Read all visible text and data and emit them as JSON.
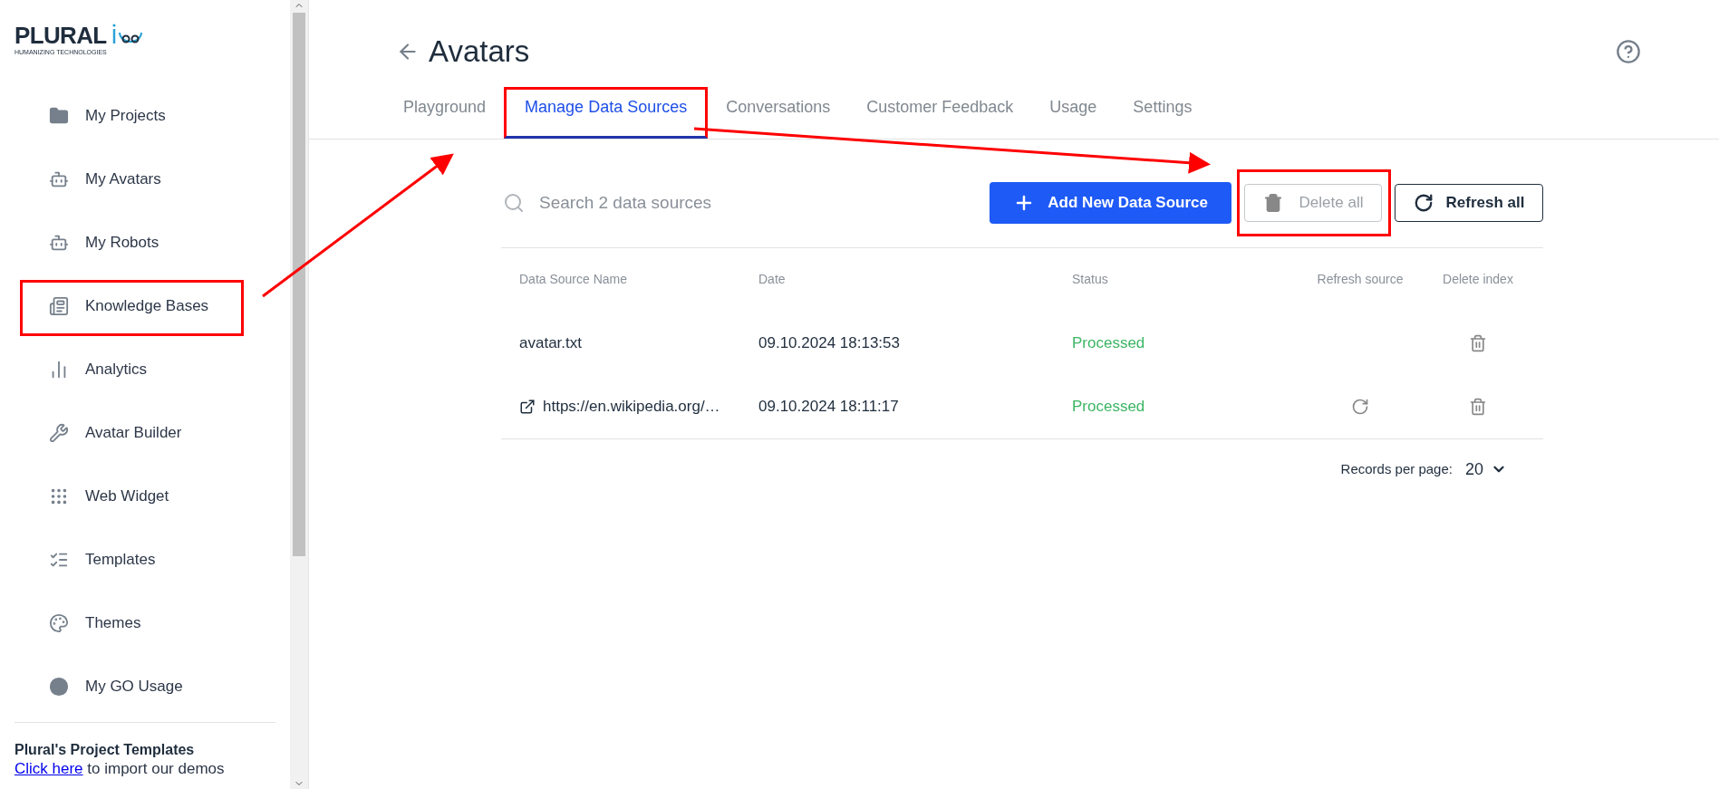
{
  "logo": {
    "name": "PLURAL",
    "tagline": "HUMANIZING TECHNOLOGIES"
  },
  "sidebar": {
    "items": [
      {
        "label": "My Projects",
        "highlighted": false
      },
      {
        "label": "My Avatars",
        "highlighted": false
      },
      {
        "label": "My Robots",
        "highlighted": false
      },
      {
        "label": "Knowledge Bases",
        "highlighted": true
      },
      {
        "label": "Analytics",
        "highlighted": false
      },
      {
        "label": "Avatar Builder",
        "highlighted": false
      },
      {
        "label": "Web Widget",
        "highlighted": false
      },
      {
        "label": "Templates",
        "highlighted": false
      },
      {
        "label": "Themes",
        "highlighted": false
      },
      {
        "label": "My GO Usage",
        "highlighted": false
      }
    ],
    "promo": {
      "title": "Plural's Project Templates",
      "link": "Click here",
      "text": " to import our demos"
    }
  },
  "header": {
    "title": "Avatars"
  },
  "tabs": [
    {
      "label": "Playground",
      "selected": false
    },
    {
      "label": "Manage Data Sources",
      "selected": true
    },
    {
      "label": "Conversations",
      "selected": false
    },
    {
      "label": "Customer Feedback",
      "selected": false
    },
    {
      "label": "Usage",
      "selected": false
    },
    {
      "label": "Settings",
      "selected": false
    }
  ],
  "search": {
    "placeholder": "Search 2 data sources"
  },
  "buttons": {
    "add": "Add New Data Source",
    "delete_all": "Delete all",
    "delete_all_disabled": true,
    "refresh_all": "Refresh all"
  },
  "table": {
    "columns": [
      "Data Source Name",
      "Date",
      "Status",
      "Refresh source",
      "Delete index"
    ],
    "rows": [
      {
        "kind": "file",
        "name": "avatar.txt",
        "date": "09.10.2024 18:13:53",
        "status": "Processed"
      },
      {
        "kind": "link",
        "name": "https://en.wikipedia.org/…",
        "date": "09.10.2024 18:11:17",
        "status": "Processed"
      }
    ]
  },
  "pagination": {
    "label": "Records per page:",
    "value": "20"
  }
}
